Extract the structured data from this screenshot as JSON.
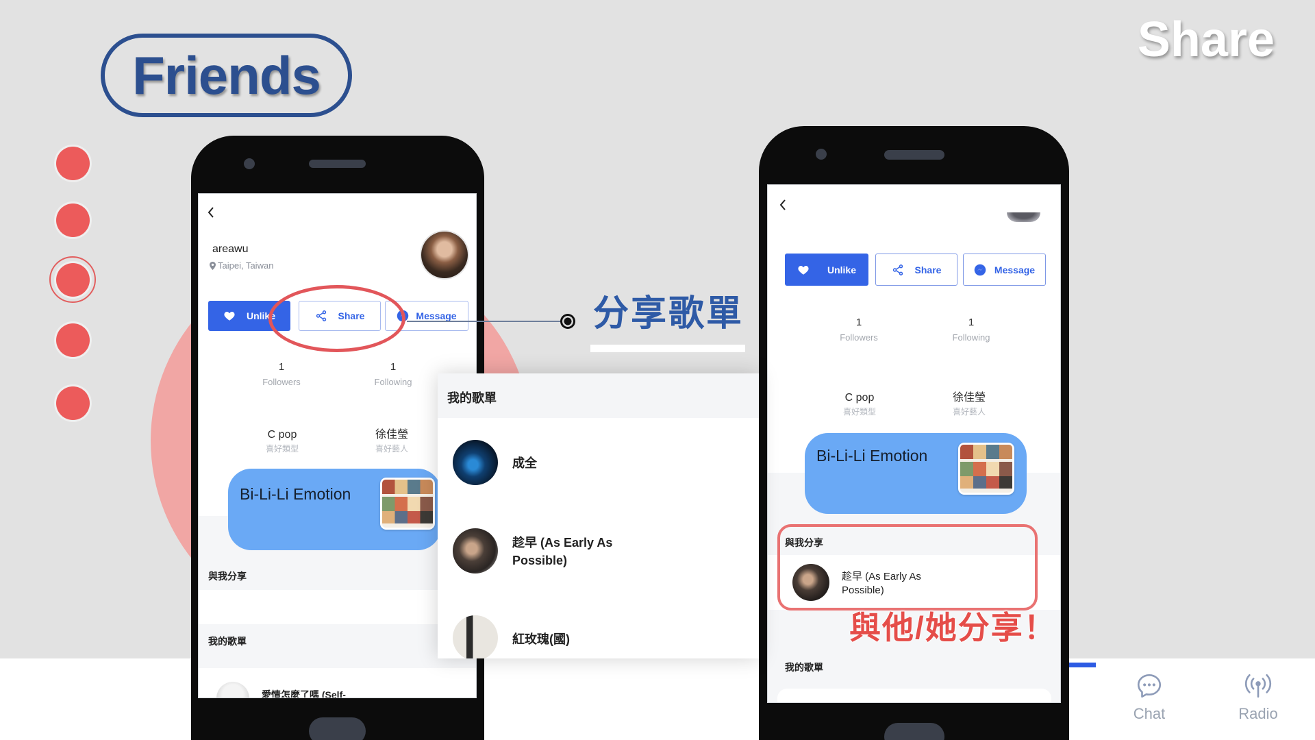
{
  "slide": {
    "title": "Friends",
    "corner_title": "Share",
    "callout_share_playlist": "分享歌單",
    "callout_share_with": "與他/她分享！"
  },
  "colors": {
    "primary_blue": "#3464e6",
    "card_blue": "#6aa9f5",
    "title_blue": "#2c4f8f",
    "highlight_red": "#e55a5a"
  },
  "left_phone": {
    "profile": {
      "name": "areawu",
      "location": "Taipei, Taiwan"
    },
    "actions": {
      "unlike": "Unlike",
      "share": "Share",
      "message": "Message"
    },
    "stats": {
      "followers_count": "1",
      "followers_label": "Followers",
      "following_count": "1",
      "following_label": "Following"
    },
    "preferences": {
      "genre": "C pop",
      "genre_label": "喜好類型",
      "artist": "徐佳瑩",
      "artist_label": "喜好藝人"
    },
    "now_playing": "Bi-Li-Li Emotion",
    "shared_with_me_heading": "與我分享",
    "my_playlists_heading": "我的歌單",
    "playlist_peek": "愛情怎麼了嗎 (Self-"
  },
  "playlist_popup": {
    "heading": "我的歌單",
    "items": [
      "成全",
      "趁早 (As Early As Possible)",
      "紅玫瑰(國)"
    ]
  },
  "right_phone": {
    "actions": {
      "unlike": "Unlike",
      "share": "Share",
      "message": "Message"
    },
    "stats": {
      "followers_count": "1",
      "followers_label": "Followers",
      "following_count": "1",
      "following_label": "Following"
    },
    "preferences": {
      "genre": "C pop",
      "genre_label": "喜好類型",
      "artist": "徐佳瑩",
      "artist_label": "喜好藝人"
    },
    "now_playing": "Bi-Li-Li Emotion",
    "shared_with_me_heading": "與我分享",
    "shared_items": [
      "趁早 (As Early As Possible)"
    ],
    "my_playlists_heading": "我的歌單"
  },
  "bottom_tabs": [
    {
      "label": "Chat",
      "icon": "chat-icon"
    },
    {
      "label": "Radio",
      "icon": "radio-icon"
    }
  ]
}
